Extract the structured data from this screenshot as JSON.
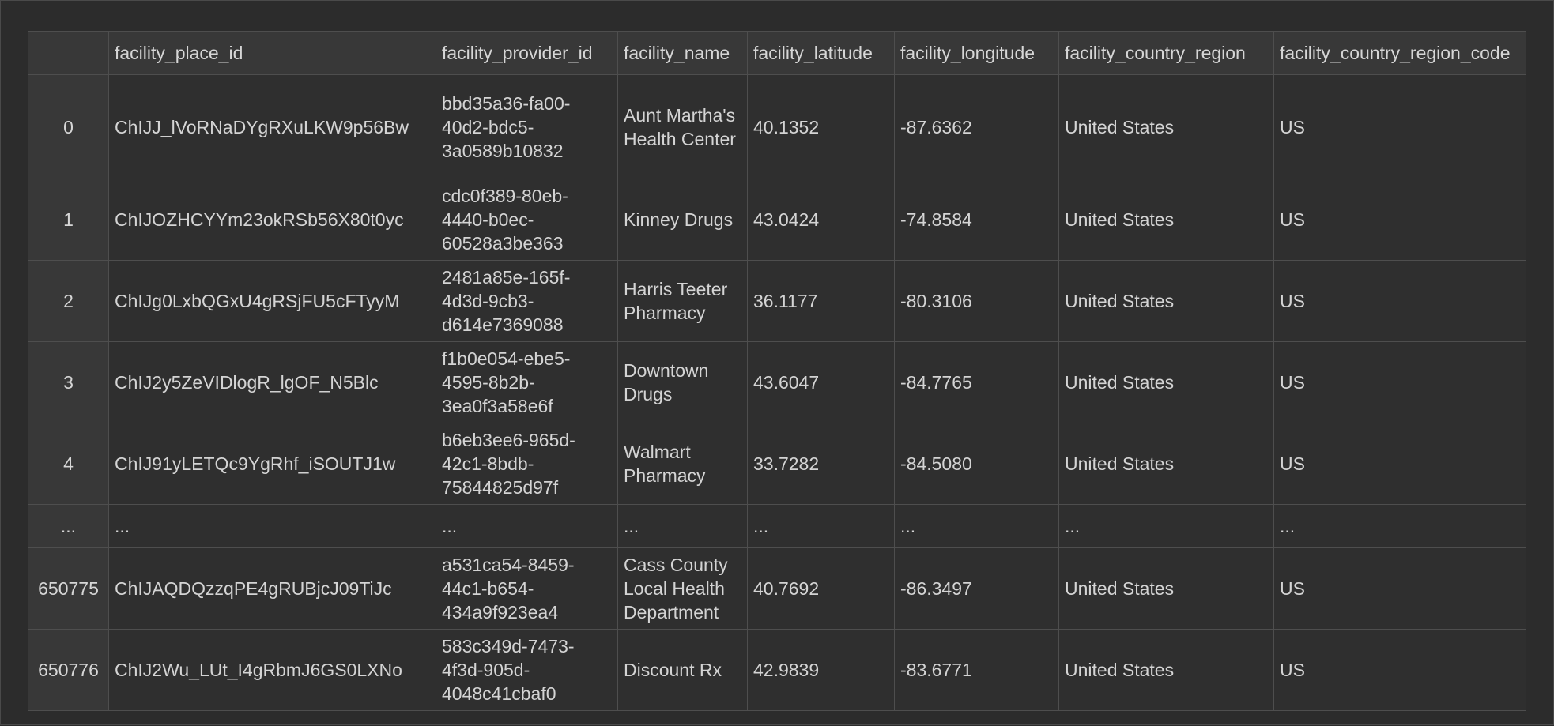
{
  "table": {
    "columns": [
      "",
      "facility_place_id",
      "facility_provider_id",
      "facility_name",
      "facility_latitude",
      "facility_longitude",
      "facility_country_region",
      "facility_country_region_code"
    ],
    "rows": [
      {
        "index": "0",
        "place_id": "ChIJJ_lVoRNaDYgRXuLKW9p56Bw",
        "provider_id": "bbd35a36-fa00-40d2-bdc5-3a0589b10832",
        "name": "Aunt Martha's Health Center",
        "latitude": "40.1352",
        "longitude": "-87.6362",
        "country_region": "United States",
        "country_region_code": "US"
      },
      {
        "index": "1",
        "place_id": "ChIJOZHCYYm23okRSb56X80t0yc",
        "provider_id": "cdc0f389-80eb-4440-b0ec-60528a3be363",
        "name": "Kinney Drugs",
        "latitude": "43.0424",
        "longitude": "-74.8584",
        "country_region": "United States",
        "country_region_code": "US"
      },
      {
        "index": "2",
        "place_id": "ChIJg0LxbQGxU4gRSjFU5cFTyyM",
        "provider_id": "2481a85e-165f-4d3d-9cb3-d614e7369088",
        "name": "Harris Teeter Pharmacy",
        "latitude": "36.1177",
        "longitude": "-80.3106",
        "country_region": "United States",
        "country_region_code": "US"
      },
      {
        "index": "3",
        "place_id": "ChIJ2y5ZeVIDlogR_lgOF_N5Blc",
        "provider_id": "f1b0e054-ebe5-4595-8b2b-3ea0f3a58e6f",
        "name": "Downtown Drugs",
        "latitude": "43.6047",
        "longitude": "-84.7765",
        "country_region": "United States",
        "country_region_code": "US"
      },
      {
        "index": "4",
        "place_id": "ChIJ91yLETQc9YgRhf_iSOUTJ1w",
        "provider_id": "b6eb3ee6-965d-42c1-8bdb-75844825d97f",
        "name": "Walmart Pharmacy",
        "latitude": "33.7282",
        "longitude": "-84.5080",
        "country_region": "United States",
        "country_region_code": "US"
      },
      {
        "index": "...",
        "place_id": "...",
        "provider_id": "...",
        "name": "...",
        "latitude": "...",
        "longitude": "...",
        "country_region": "...",
        "country_region_code": "..."
      },
      {
        "index": "650775",
        "place_id": "ChIJAQDQzzqPE4gRUBjcJ09TiJc",
        "provider_id": "a531ca54-8459-44c1-b654-434a9f923ea4",
        "name": "Cass County Local Health Department",
        "latitude": "40.7692",
        "longitude": "-86.3497",
        "country_region": "United States",
        "country_region_code": "US"
      },
      {
        "index": "650776",
        "place_id": "ChIJ2Wu_LUt_I4gRbmJ6GS0LXNo",
        "provider_id": "583c349d-7473-4f3d-905d-4048c41cbaf0",
        "name": "Discount Rx",
        "latitude": "42.9839",
        "longitude": "-83.6771",
        "country_region": "United States",
        "country_region_code": "US"
      }
    ]
  }
}
